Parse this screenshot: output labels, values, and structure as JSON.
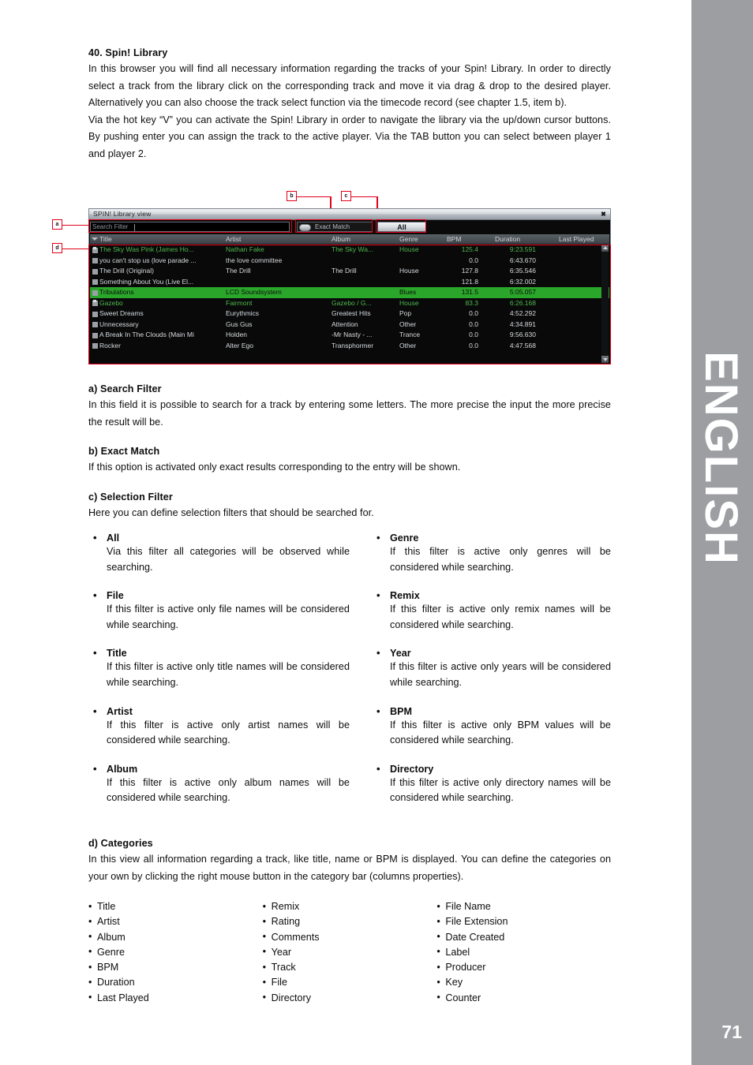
{
  "language_bar": {
    "label": "ENGLISH",
    "page_number": "71"
  },
  "intro": {
    "heading": "40. Spin! Library",
    "paragraph1": "In this browser you will find all necessary information regarding the tracks of your Spin!  Library. In order to directly select a track from the library click on the corresponding track and move it via drag & drop to the desired player. Alternatively you can also choose the track select function via the timecode record (see chapter 1.5, item b).",
    "paragraph2": "Via the hot key “V” you can activate the Spin! Library in order to navigate the library via the up/down cursor buttons. By pushing enter you can assign the track to the active player. Via the TAB button you can select between player 1 and player 2."
  },
  "figure": {
    "callouts": {
      "a": "a",
      "b": "b",
      "c": "c",
      "d": "d"
    },
    "window": {
      "title": "SPIN! Library view",
      "close_label": "✖",
      "search_placeholder": "Search Filter",
      "search_value": "",
      "exact_match_label": "Exact Match",
      "all_button_label": "All"
    },
    "table": {
      "columns": [
        "Title",
        "Artist",
        "Album",
        "Genre",
        "BPM",
        "Duration",
        "Last Played"
      ],
      "rows": [
        {
          "icon": "note-icon",
          "title": "The Sky Was Pink (James Ho...",
          "artist": "Nathan Fake",
          "album": "The Sky Wa...",
          "genre": "House",
          "bpm": "125.4",
          "duration": "9:23.591",
          "last_played": "",
          "state": "played"
        },
        {
          "icon": "track-icon",
          "title": "you can't stop us (love parade ...",
          "artist": "the love committee",
          "album": "",
          "genre": "",
          "bpm": "0.0",
          "duration": "6:43.670",
          "last_played": "",
          "state": "normal"
        },
        {
          "icon": "track-icon",
          "title": "The Drill (Original)",
          "artist": "The Drill",
          "album": "The Drill",
          "genre": "House",
          "bpm": "127.8",
          "duration": "6:35.546",
          "last_played": "",
          "state": "normal"
        },
        {
          "icon": "track-icon",
          "title": "Something About You (Live El...",
          "artist": "",
          "album": "",
          "genre": "",
          "bpm": "121.8",
          "duration": "6:32.002",
          "last_played": "",
          "state": "normal"
        },
        {
          "icon": "track-icon",
          "title": "Tribulations",
          "artist": "LCD Soundsystem",
          "album": "",
          "genre": "Blues",
          "bpm": "131.5",
          "duration": "5:05.057",
          "last_played": "",
          "state": "selected"
        },
        {
          "icon": "note-icon",
          "title": "Gazebo",
          "artist": "Fairmont",
          "album": "Gazebo / G...",
          "genre": "House",
          "bpm": "83.3",
          "duration": "6:26.168",
          "last_played": "",
          "state": "played"
        },
        {
          "icon": "track-icon",
          "title": "Sweet Dreams",
          "artist": "Eurythmics",
          "album": "Greatest Hits",
          "genre": "Pop",
          "bpm": "0.0",
          "duration": "4:52.292",
          "last_played": "",
          "state": "normal"
        },
        {
          "icon": "track-icon",
          "title": "Unnecessary",
          "artist": "Gus Gus",
          "album": "Attention",
          "genre": "Other",
          "bpm": "0.0",
          "duration": "4:34.891",
          "last_played": "",
          "state": "normal"
        },
        {
          "icon": "track-icon",
          "title": "A Break In The Clouds (Main Mi",
          "artist": "Holden",
          "album": "-Mr Nasty - ...",
          "genre": "Trance",
          "bpm": "0.0",
          "duration": "9:56.630",
          "last_played": "",
          "state": "normal"
        },
        {
          "icon": "track-icon",
          "title": "Rocker",
          "artist": "Alter Ego",
          "album": "Transphormer",
          "genre": "Other",
          "bpm": "0.0",
          "duration": "4:47.568",
          "last_played": "",
          "state": "normal"
        }
      ]
    }
  },
  "sections": [
    {
      "heading": "a) Search Filter",
      "text": "In this field it is possible to search for a track by entering some letters. The more precise the input the more precise the result will be."
    },
    {
      "heading": "b) Exact Match",
      "text": "If this option is activated only exact results corresponding to the entry will be shown."
    },
    {
      "heading": "c) Selection Filter",
      "text": "Here you can define selection filters that should be searched for."
    }
  ],
  "filters": {
    "left": [
      {
        "name": "All",
        "desc": "Via this filter all categories will be observed while searching."
      },
      {
        "name": "File",
        "desc": "If this filter is active only file names will be considered while searching."
      },
      {
        "name": "Title",
        "desc": "If this filter is active only title names will be considered while searching."
      },
      {
        "name": "Artist",
        "desc": "If this filter is active only artist names will be considered while searching."
      },
      {
        "name": "Album",
        "desc": "If this filter is active only album names will be considered while searching."
      }
    ],
    "right": [
      {
        "name": "Genre",
        "desc": "If this filter is active only genres will be considered while searching."
      },
      {
        "name": "Remix",
        "desc": "If this filter is active only remix names will be considered while searching."
      },
      {
        "name": "Year",
        "desc": "If this filter is active only years will be considered while searching."
      },
      {
        "name": "BPM",
        "desc": "If this filter is active only BPM values will be considered while searching."
      },
      {
        "name": "Directory",
        "desc": "If this filter is active only directory names will be considered while searching."
      }
    ]
  },
  "categories_section": {
    "heading": "d) Categories",
    "text": "In this view all information regarding a track, like title, name or BPM is displayed. You can define the categories on your own by clicking the right mouse button in the category bar (columns properties).",
    "columns": [
      [
        "Title",
        "Artist",
        "Album",
        "Genre",
        "BPM",
        "Duration",
        "Last Played"
      ],
      [
        "Remix",
        "Rating",
        "Comments",
        "Year",
        "Track",
        "File",
        "Directory"
      ],
      [
        "File Name",
        "File Extension",
        "Date Created",
        "Label",
        "Producer",
        "Key",
        "Counter"
      ]
    ]
  },
  "colors": {
    "accent_red": "#e2001a",
    "sidebar_gray": "#9c9ea1",
    "selection_green": "#2aa62a",
    "played_green": "#4fb84f"
  }
}
